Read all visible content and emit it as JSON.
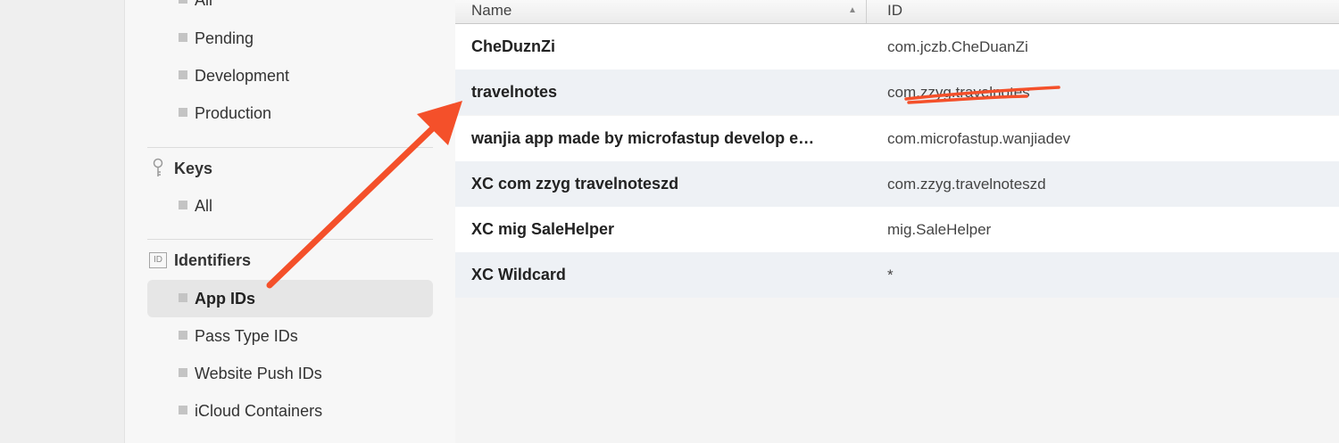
{
  "sidebar": {
    "items_top": [
      {
        "label": "All"
      },
      {
        "label": "Pending"
      },
      {
        "label": "Development"
      },
      {
        "label": "Production"
      }
    ],
    "keys": {
      "title": "Keys",
      "items": [
        {
          "label": "All"
        }
      ]
    },
    "identifiers": {
      "title": "Identifiers",
      "icon_text": "ID",
      "items": [
        {
          "label": "App IDs"
        },
        {
          "label": "Pass Type IDs"
        },
        {
          "label": "Website Push IDs"
        },
        {
          "label": "iCloud Containers"
        }
      ]
    }
  },
  "table": {
    "columns": [
      "Name",
      "ID"
    ],
    "rows": [
      {
        "name": "CheDuznZi",
        "id": "com.jczb.CheDuanZi"
      },
      {
        "name": "travelnotes",
        "id": "com.zzyg.travelnotes"
      },
      {
        "name": "wanjia app made by microfastup develop e…",
        "id": "com.microfastup.wanjiadev"
      },
      {
        "name": "XC com zzyg travelnoteszd",
        "id": "com.zzyg.travelnoteszd"
      },
      {
        "name": "XC mig SaleHelper",
        "id": "mig.SaleHelper"
      },
      {
        "name": "XC Wildcard",
        "id": "*"
      }
    ]
  },
  "colors": {
    "annotation": "#f4502a",
    "row_alt": "#eef1f5",
    "row": "#ffffff"
  }
}
